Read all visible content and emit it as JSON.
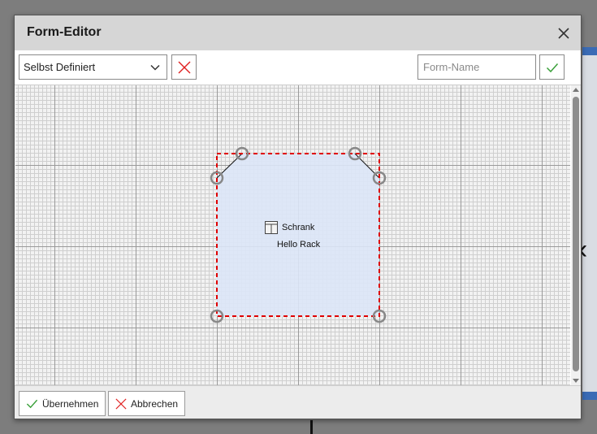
{
  "dialog": {
    "title": "Form-Editor",
    "close_icon": "close-icon"
  },
  "toolbar": {
    "shape_select_value": "Selbst Definiert",
    "delete_icon": "x-icon",
    "name_placeholder": "Form-Name",
    "name_value": "",
    "confirm_icon": "check-icon"
  },
  "canvas": {
    "shape_title": "Schrank",
    "shape_subtitle": "Hello Rack",
    "shape_icon": "cabinet-icon",
    "shape_fill": "#dce6f7",
    "selection_color": "#e00000",
    "handle_color": "#888888"
  },
  "footer": {
    "apply_label": "Übernehmen",
    "cancel_label": "Abbrechen"
  },
  "colors": {
    "accept": "#3aa03a",
    "reject": "#e02020"
  }
}
